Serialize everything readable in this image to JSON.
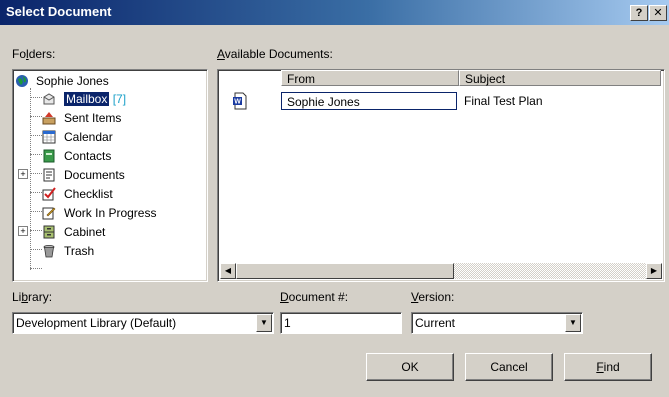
{
  "window": {
    "title": "Select Document",
    "help_button": "?",
    "close_button": "✕"
  },
  "folders": {
    "label_prefix": "Fo",
    "label_accel": "l",
    "label_suffix": "ders:",
    "root": "Sophie Jones",
    "items": [
      {
        "label": "Mailbox",
        "count": "[7]",
        "icon": "mailbox-icon",
        "selected": true
      },
      {
        "label": "Sent Items",
        "icon": "sent-items-icon"
      },
      {
        "label": "Calendar",
        "icon": "calendar-icon"
      },
      {
        "label": "Contacts",
        "icon": "contacts-icon"
      },
      {
        "label": "Documents",
        "icon": "documents-icon",
        "expandable": true
      },
      {
        "label": "Checklist",
        "icon": "checklist-icon"
      },
      {
        "label": "Work In Progress",
        "icon": "work-in-progress-icon"
      },
      {
        "label": "Cabinet",
        "icon": "cabinet-icon",
        "expandable": true
      },
      {
        "label": "Trash",
        "icon": "trash-icon"
      }
    ]
  },
  "documents": {
    "label_accel": "A",
    "label_suffix": "vailable Documents:",
    "columns": [
      "From",
      "Subject"
    ],
    "rows": [
      {
        "icon": "word-document-icon",
        "from": "Sophie Jones",
        "subject": "Final Test Plan"
      }
    ]
  },
  "library": {
    "label_prefix": "Li",
    "label_accel": "b",
    "label_suffix": "rary:",
    "value": "Development Library (Default)"
  },
  "document_number": {
    "label_accel": "D",
    "label_suffix": "ocument #:",
    "value": "1"
  },
  "version": {
    "label_accel": "V",
    "label_suffix": "ersion:",
    "value": "Current"
  },
  "buttons": {
    "ok": "OK",
    "cancel": "Cancel",
    "find_accel": "F",
    "find_suffix": "ind"
  }
}
